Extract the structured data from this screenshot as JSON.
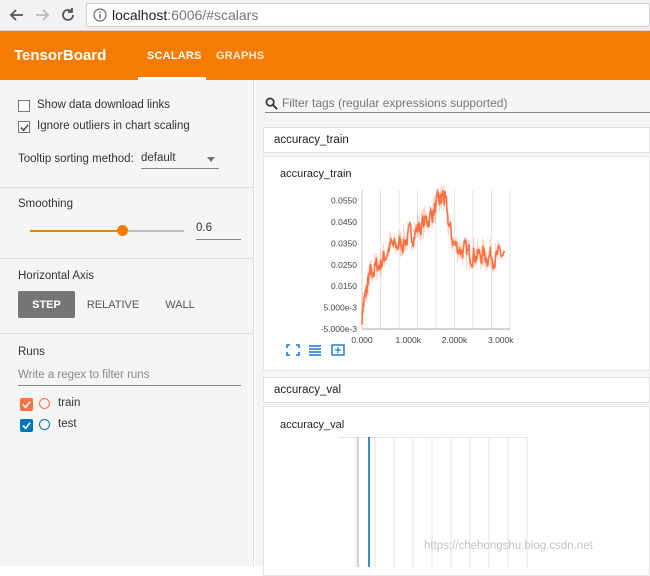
{
  "browser": {
    "url_host": "localhost",
    "url_path": ":6006/#scalars"
  },
  "header": {
    "brand": "TensorBoard",
    "tabs": [
      {
        "label": "SCALARS",
        "active": true
      },
      {
        "label": "GRAPHS",
        "active": false
      }
    ],
    "color": "#f57c00"
  },
  "sidebar": {
    "show_download_links": {
      "label": "Show data download links",
      "checked": false
    },
    "ignore_outliers": {
      "label": "Ignore outliers in chart scaling",
      "checked": true
    },
    "tooltip_sort": {
      "label": "Tooltip sorting method:",
      "value": "default"
    },
    "smoothing": {
      "title": "Smoothing",
      "value": "0.6",
      "fraction": 0.6
    },
    "horizontal_axis": {
      "title": "Horizontal Axis",
      "options": [
        "STEP",
        "RELATIVE",
        "WALL"
      ],
      "selected": "STEP"
    },
    "runs": {
      "title": "Runs",
      "filter_placeholder": "Write a regex to filter runs",
      "items": [
        {
          "name": "train",
          "color": "#ff7043",
          "checked": true
        },
        {
          "name": "test",
          "color": "#0077bb",
          "checked": true
        }
      ]
    }
  },
  "main": {
    "filter_placeholder": "Filter tags (regular expressions supported)",
    "groups": [
      {
        "name": "accuracy_train"
      },
      {
        "name": "accuracy_val"
      }
    ]
  },
  "chart_data": [
    {
      "type": "line",
      "title": "accuracy_train",
      "xlabel": "",
      "ylabel": "",
      "xlim": [
        0,
        3200
      ],
      "ylim": [
        -0.005,
        0.06
      ],
      "x_ticks": [
        "0.000",
        "1.000k",
        "2.000k",
        "3.000k"
      ],
      "x_tick_values": [
        0,
        1000,
        2000,
        3000
      ],
      "y_ticks": [
        "0.0550",
        "0.0450",
        "0.0350",
        "0.0250",
        "0.0150",
        "5.000e-3",
        "-5.000e-3"
      ],
      "y_tick_values": [
        0.055,
        0.045,
        0.035,
        0.025,
        0.015,
        0.005,
        -0.005
      ],
      "grid": true,
      "series": [
        {
          "name": "train",
          "color": "#ff7043",
          "x": [
            0,
            50,
            100,
            150,
            200,
            300,
            400,
            500,
            600,
            700,
            800,
            900,
            1000,
            1100,
            1200,
            1300,
            1400,
            1500,
            1600,
            1700,
            1750,
            1800,
            1900,
            2000,
            2100,
            2200,
            2300,
            2400,
            2500,
            2600,
            2700,
            2800,
            2900,
            3000,
            3100
          ],
          "values": [
            0.005,
            0.008,
            0.014,
            0.018,
            0.022,
            0.024,
            0.026,
            0.03,
            0.034,
            0.033,
            0.035,
            0.036,
            0.038,
            0.04,
            0.042,
            0.044,
            0.046,
            0.049,
            0.052,
            0.055,
            0.058,
            0.053,
            0.04,
            0.034,
            0.033,
            0.031,
            0.03,
            0.031,
            0.029,
            0.03,
            0.029,
            0.03,
            0.028,
            0.03,
            0.028
          ]
        }
      ]
    },
    {
      "type": "line",
      "title": "accuracy_val",
      "xlabel": "",
      "ylabel": "",
      "grid": true,
      "series": [
        {
          "name": "test",
          "color": "#0077bb"
        }
      ]
    }
  ],
  "footer": {
    "watermark": "https://chehongshu.blog.csdn.net"
  }
}
